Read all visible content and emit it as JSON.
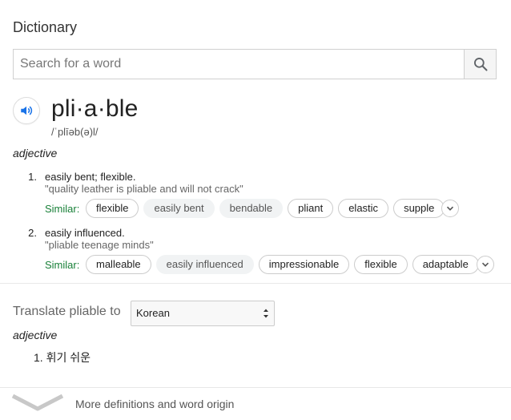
{
  "header": {
    "title": "Dictionary"
  },
  "search": {
    "placeholder": "Search for a word",
    "value": ""
  },
  "entry": {
    "word": "pli·a·ble",
    "phonetic": "/ˈplīəb(ə)l/",
    "part_of_speech": "adjective",
    "senses": [
      {
        "number": "1.",
        "definition": "easily bent; flexible.",
        "example": "\"quality leather is pliable and will not crack\"",
        "similar_label": "Similar:",
        "similar": [
          {
            "word": "flexible",
            "style": "outlined"
          },
          {
            "word": "easily bent",
            "style": "filled"
          },
          {
            "word": "bendable",
            "style": "filled"
          },
          {
            "word": "pliant",
            "style": "outlined"
          },
          {
            "word": "elastic",
            "style": "outlined"
          },
          {
            "word": "supple",
            "style": "outlined"
          }
        ]
      },
      {
        "number": "2.",
        "definition": "easily influenced.",
        "example": "\"pliable teenage minds\"",
        "similar_label": "Similar:",
        "similar": [
          {
            "word": "malleable",
            "style": "outlined"
          },
          {
            "word": "easily influenced",
            "style": "filled"
          },
          {
            "word": "impressionable",
            "style": "outlined"
          },
          {
            "word": "flexible",
            "style": "outlined"
          },
          {
            "word": "adaptable",
            "style": "outlined"
          }
        ]
      }
    ]
  },
  "translate": {
    "label": "Translate pliable to",
    "language": "Korean",
    "part_of_speech": "adjective",
    "results": [
      {
        "number": "1.",
        "text": "휘기 쉬운"
      }
    ]
  },
  "footer": {
    "more_label": "More definitions and word origin"
  },
  "colors": {
    "speaker_blue": "#1a73e8",
    "similar_green": "#188038"
  },
  "icons": {
    "search": "search-icon",
    "speaker": "speaker-icon",
    "expand": "chevron-down-icon",
    "more": "chevron-down-icon"
  }
}
